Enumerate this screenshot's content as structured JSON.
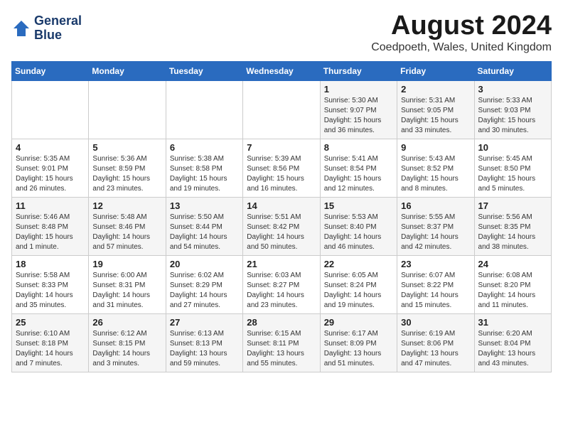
{
  "header": {
    "logo_line1": "General",
    "logo_line2": "Blue",
    "title": "August 2024",
    "subtitle": "Coedpoeth, Wales, United Kingdom"
  },
  "weekdays": [
    "Sunday",
    "Monday",
    "Tuesday",
    "Wednesday",
    "Thursday",
    "Friday",
    "Saturday"
  ],
  "weeks": [
    [
      {
        "day": "",
        "info": ""
      },
      {
        "day": "",
        "info": ""
      },
      {
        "day": "",
        "info": ""
      },
      {
        "day": "",
        "info": ""
      },
      {
        "day": "1",
        "info": "Sunrise: 5:30 AM\nSunset: 9:07 PM\nDaylight: 15 hours\nand 36 minutes."
      },
      {
        "day": "2",
        "info": "Sunrise: 5:31 AM\nSunset: 9:05 PM\nDaylight: 15 hours\nand 33 minutes."
      },
      {
        "day": "3",
        "info": "Sunrise: 5:33 AM\nSunset: 9:03 PM\nDaylight: 15 hours\nand 30 minutes."
      }
    ],
    [
      {
        "day": "4",
        "info": "Sunrise: 5:35 AM\nSunset: 9:01 PM\nDaylight: 15 hours\nand 26 minutes."
      },
      {
        "day": "5",
        "info": "Sunrise: 5:36 AM\nSunset: 8:59 PM\nDaylight: 15 hours\nand 23 minutes."
      },
      {
        "day": "6",
        "info": "Sunrise: 5:38 AM\nSunset: 8:58 PM\nDaylight: 15 hours\nand 19 minutes."
      },
      {
        "day": "7",
        "info": "Sunrise: 5:39 AM\nSunset: 8:56 PM\nDaylight: 15 hours\nand 16 minutes."
      },
      {
        "day": "8",
        "info": "Sunrise: 5:41 AM\nSunset: 8:54 PM\nDaylight: 15 hours\nand 12 minutes."
      },
      {
        "day": "9",
        "info": "Sunrise: 5:43 AM\nSunset: 8:52 PM\nDaylight: 15 hours\nand 8 minutes."
      },
      {
        "day": "10",
        "info": "Sunrise: 5:45 AM\nSunset: 8:50 PM\nDaylight: 15 hours\nand 5 minutes."
      }
    ],
    [
      {
        "day": "11",
        "info": "Sunrise: 5:46 AM\nSunset: 8:48 PM\nDaylight: 15 hours\nand 1 minute."
      },
      {
        "day": "12",
        "info": "Sunrise: 5:48 AM\nSunset: 8:46 PM\nDaylight: 14 hours\nand 57 minutes."
      },
      {
        "day": "13",
        "info": "Sunrise: 5:50 AM\nSunset: 8:44 PM\nDaylight: 14 hours\nand 54 minutes."
      },
      {
        "day": "14",
        "info": "Sunrise: 5:51 AM\nSunset: 8:42 PM\nDaylight: 14 hours\nand 50 minutes."
      },
      {
        "day": "15",
        "info": "Sunrise: 5:53 AM\nSunset: 8:40 PM\nDaylight: 14 hours\nand 46 minutes."
      },
      {
        "day": "16",
        "info": "Sunrise: 5:55 AM\nSunset: 8:37 PM\nDaylight: 14 hours\nand 42 minutes."
      },
      {
        "day": "17",
        "info": "Sunrise: 5:56 AM\nSunset: 8:35 PM\nDaylight: 14 hours\nand 38 minutes."
      }
    ],
    [
      {
        "day": "18",
        "info": "Sunrise: 5:58 AM\nSunset: 8:33 PM\nDaylight: 14 hours\nand 35 minutes."
      },
      {
        "day": "19",
        "info": "Sunrise: 6:00 AM\nSunset: 8:31 PM\nDaylight: 14 hours\nand 31 minutes."
      },
      {
        "day": "20",
        "info": "Sunrise: 6:02 AM\nSunset: 8:29 PM\nDaylight: 14 hours\nand 27 minutes."
      },
      {
        "day": "21",
        "info": "Sunrise: 6:03 AM\nSunset: 8:27 PM\nDaylight: 14 hours\nand 23 minutes."
      },
      {
        "day": "22",
        "info": "Sunrise: 6:05 AM\nSunset: 8:24 PM\nDaylight: 14 hours\nand 19 minutes."
      },
      {
        "day": "23",
        "info": "Sunrise: 6:07 AM\nSunset: 8:22 PM\nDaylight: 14 hours\nand 15 minutes."
      },
      {
        "day": "24",
        "info": "Sunrise: 6:08 AM\nSunset: 8:20 PM\nDaylight: 14 hours\nand 11 minutes."
      }
    ],
    [
      {
        "day": "25",
        "info": "Sunrise: 6:10 AM\nSunset: 8:18 PM\nDaylight: 14 hours\nand 7 minutes."
      },
      {
        "day": "26",
        "info": "Sunrise: 6:12 AM\nSunset: 8:15 PM\nDaylight: 14 hours\nand 3 minutes."
      },
      {
        "day": "27",
        "info": "Sunrise: 6:13 AM\nSunset: 8:13 PM\nDaylight: 13 hours\nand 59 minutes."
      },
      {
        "day": "28",
        "info": "Sunrise: 6:15 AM\nSunset: 8:11 PM\nDaylight: 13 hours\nand 55 minutes."
      },
      {
        "day": "29",
        "info": "Sunrise: 6:17 AM\nSunset: 8:09 PM\nDaylight: 13 hours\nand 51 minutes."
      },
      {
        "day": "30",
        "info": "Sunrise: 6:19 AM\nSunset: 8:06 PM\nDaylight: 13 hours\nand 47 minutes."
      },
      {
        "day": "31",
        "info": "Sunrise: 6:20 AM\nSunset: 8:04 PM\nDaylight: 13 hours\nand 43 minutes."
      }
    ]
  ]
}
